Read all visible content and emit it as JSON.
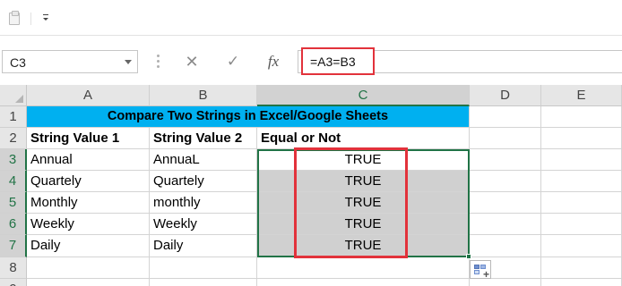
{
  "formula_bar": {
    "name_box": "C3",
    "cancel_icon": "✕",
    "enter_icon": "✓",
    "fx_label": "fx",
    "formula": "=A3=B3"
  },
  "columns": [
    "A",
    "B",
    "C",
    "D",
    "E"
  ],
  "rows": [
    "1",
    "2",
    "3",
    "4",
    "5",
    "6",
    "7",
    "8",
    "9"
  ],
  "sheet": {
    "title": "Compare Two Strings in Excel/Google Sheets",
    "headers": [
      "String Value 1",
      "String Value 2",
      "Equal or Not"
    ],
    "data": [
      [
        "Annual",
        "AnnuaL",
        "TRUE"
      ],
      [
        "Quartely",
        "Quartely",
        "TRUE"
      ],
      [
        "Monthly",
        "monthly",
        "TRUE"
      ],
      [
        "Weekly",
        "Weekly",
        "TRUE"
      ],
      [
        "Daily",
        "Daily",
        "TRUE"
      ]
    ]
  },
  "colors": {
    "title_fill": "#00b0f0",
    "selection": "#217346",
    "highlight_box": "#e2323b",
    "selected_fill": "#d0d0d0"
  },
  "icons": {
    "clipboard": "clipboard-icon",
    "customize_qat": "chevron-down-icon",
    "quick_analysis": "quick-analysis-icon"
  }
}
